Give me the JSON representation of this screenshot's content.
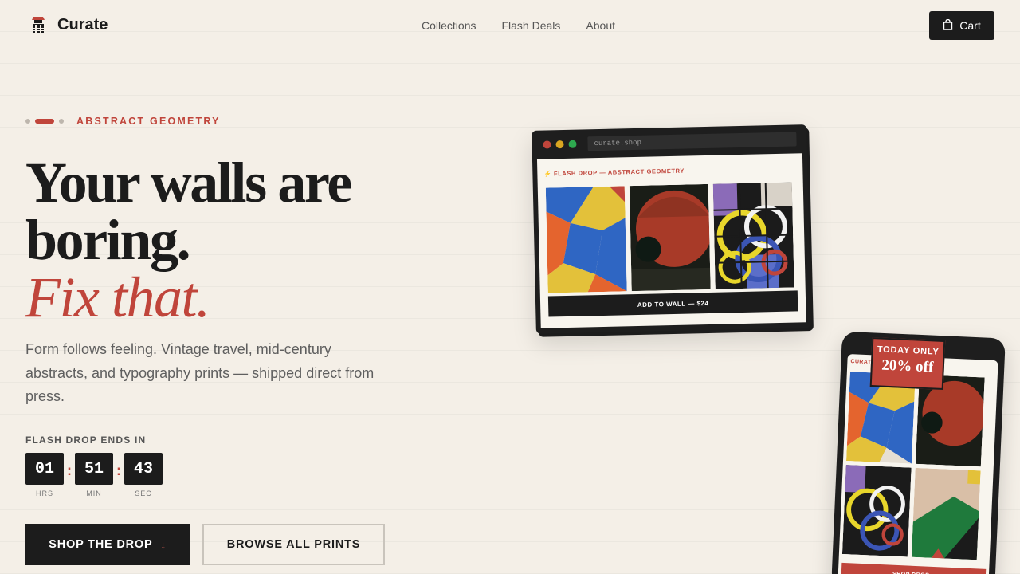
{
  "brand": {
    "name": "Curate",
    "icon": "stacked-logo-icon"
  },
  "nav": {
    "links": [
      "Collections",
      "Flash Deals",
      "About"
    ],
    "cart_label": "Cart",
    "cart_icon": "shopping-bag-icon"
  },
  "hero": {
    "eyebrow": "ABSTRACT GEOMETRY",
    "headline_line1": "Your walls are",
    "headline_line2": "boring.",
    "headline_accent": "Fix that.",
    "subtitle": "Form follows feeling. Vintage travel, mid-century abstracts, and typography prints — shipped direct from press."
  },
  "countdown": {
    "label": "FLASH DROP ENDS IN",
    "units": [
      {
        "value": "01",
        "caption": "HRS"
      },
      {
        "value": "51",
        "caption": "MIN"
      },
      {
        "value": "43",
        "caption": "SEC"
      }
    ],
    "separator": ":"
  },
  "cta": {
    "primary_label": "SHOP THE DROP",
    "primary_icon": "arrow-down-icon",
    "secondary_label": "BROWSE ALL PRINTS"
  },
  "browser_mock": {
    "url": "curate.shop",
    "drop_title": "⚡ FLASH DROP — ABSTRACT GEOMETRY",
    "button_label": "ADD TO WALL — $24"
  },
  "phone_mock": {
    "brand": "CURATE",
    "button_label": "SHOP DROP ↓"
  },
  "badge": {
    "line1": "TODAY ONLY",
    "line2": "20% off"
  },
  "colors": {
    "accent": "#c0453b",
    "ink": "#1c1c1c",
    "background": "#f4efe7"
  }
}
